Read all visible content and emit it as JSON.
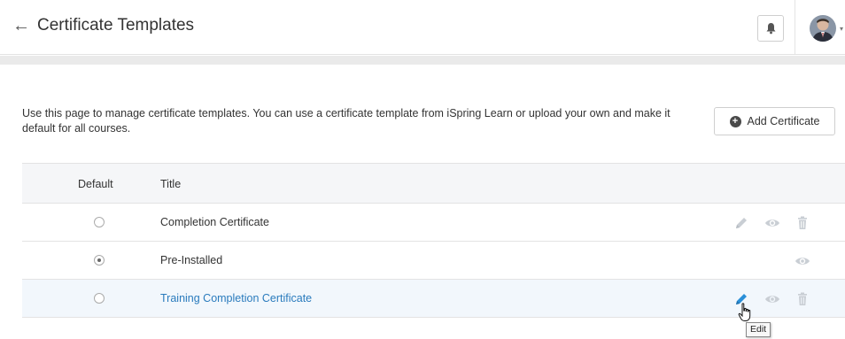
{
  "header": {
    "title": "Certificate Templates"
  },
  "intro": {
    "description": "Use this page to manage certificate templates. You can use a certificate template from iSpring Learn or upload your own and make it default for all courses.",
    "add_button_label": "Add Certificate"
  },
  "table": {
    "columns": [
      "Default",
      "Title"
    ],
    "rows": [
      {
        "title": "Completion Certificate",
        "default": false,
        "actions": [
          "edit",
          "view",
          "delete"
        ]
      },
      {
        "title": "Pre-Installed",
        "default": true,
        "actions": [
          "view"
        ]
      },
      {
        "title": "Training Completion Certificate",
        "default": false,
        "actions": [
          "edit",
          "view",
          "delete"
        ],
        "hovered": true
      }
    ]
  },
  "tooltip": {
    "text": "Edit"
  },
  "icons": {
    "back": "back-arrow-icon",
    "notifications": "bell-icon",
    "add": "plus-circle-icon",
    "edit": "pencil-icon",
    "view": "eye-icon",
    "delete": "trash-icon",
    "cursor": "hand-pointer-icon"
  },
  "colors": {
    "accent_link": "#2a7bbd",
    "icon_inactive": "#c9ced4",
    "icon_hover": "#2a8fd8",
    "row_highlight": "#f2f7fc",
    "header_band": "#eaeaea"
  }
}
